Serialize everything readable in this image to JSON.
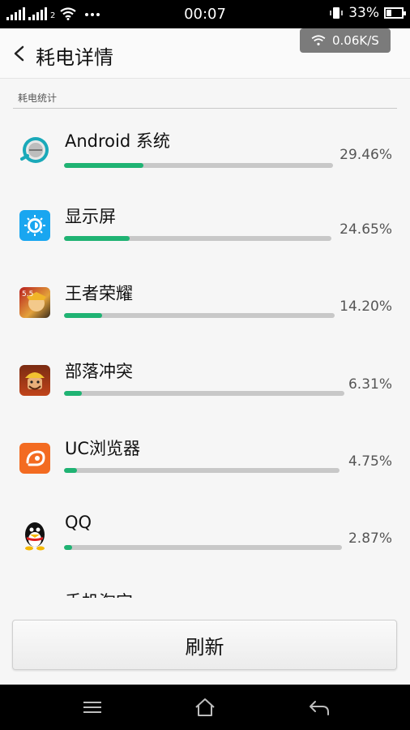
{
  "status_bar": {
    "time": "00:07",
    "battery_text": "33%",
    "battery_level": 0.33,
    "sim_badge": "2",
    "more_icon": "ellipsis-icon"
  },
  "header": {
    "title": "耗电详情",
    "network_speed": "0.06K/S"
  },
  "section": {
    "label": "耗电统计"
  },
  "apps": [
    {
      "name": "Android 系统",
      "percent": "29.46%",
      "value": 29.46,
      "icon": "android-system-icon"
    },
    {
      "name": "显示屏",
      "percent": "24.65%",
      "value": 24.65,
      "icon": "display-brightness-icon"
    },
    {
      "name": "王者荣耀",
      "percent": "14.20%",
      "value": 14.2,
      "icon": "honor-of-kings-icon"
    },
    {
      "name": "部落冲突",
      "percent": "6.31%",
      "value": 6.31,
      "icon": "clash-of-clans-icon"
    },
    {
      "name": "UC浏览器",
      "percent": "4.75%",
      "value": 4.75,
      "icon": "uc-browser-icon"
    },
    {
      "name": "QQ",
      "percent": "2.87%",
      "value": 2.87,
      "icon": "qq-penguin-icon"
    },
    {
      "name": "手机淘宝",
      "percent": "",
      "value": null,
      "icon": "taobao-icon"
    }
  ],
  "refresh_button": {
    "label": "刷新"
  },
  "nav": {
    "menu_icon": "menu-icon",
    "home_icon": "home-icon",
    "back_icon": "back-arrow-icon"
  },
  "colors": {
    "accent_green": "#1fb373",
    "bar_track": "#c8c8c8",
    "status_bar_bg": "#000000"
  }
}
